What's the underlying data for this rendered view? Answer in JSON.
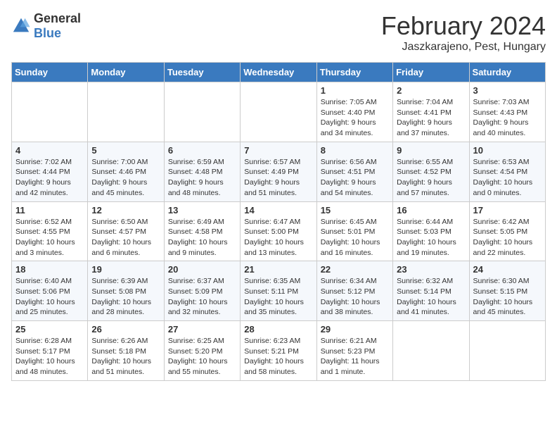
{
  "header": {
    "logo_general": "General",
    "logo_blue": "Blue",
    "month_year": "February 2024",
    "location": "Jaszkarajeno, Pest, Hungary"
  },
  "days_of_week": [
    "Sunday",
    "Monday",
    "Tuesday",
    "Wednesday",
    "Thursday",
    "Friday",
    "Saturday"
  ],
  "weeks": [
    [
      {
        "day": "",
        "info": ""
      },
      {
        "day": "",
        "info": ""
      },
      {
        "day": "",
        "info": ""
      },
      {
        "day": "",
        "info": ""
      },
      {
        "day": "1",
        "info": "Sunrise: 7:05 AM\nSunset: 4:40 PM\nDaylight: 9 hours\nand 34 minutes."
      },
      {
        "day": "2",
        "info": "Sunrise: 7:04 AM\nSunset: 4:41 PM\nDaylight: 9 hours\nand 37 minutes."
      },
      {
        "day": "3",
        "info": "Sunrise: 7:03 AM\nSunset: 4:43 PM\nDaylight: 9 hours\nand 40 minutes."
      }
    ],
    [
      {
        "day": "4",
        "info": "Sunrise: 7:02 AM\nSunset: 4:44 PM\nDaylight: 9 hours\nand 42 minutes."
      },
      {
        "day": "5",
        "info": "Sunrise: 7:00 AM\nSunset: 4:46 PM\nDaylight: 9 hours\nand 45 minutes."
      },
      {
        "day": "6",
        "info": "Sunrise: 6:59 AM\nSunset: 4:48 PM\nDaylight: 9 hours\nand 48 minutes."
      },
      {
        "day": "7",
        "info": "Sunrise: 6:57 AM\nSunset: 4:49 PM\nDaylight: 9 hours\nand 51 minutes."
      },
      {
        "day": "8",
        "info": "Sunrise: 6:56 AM\nSunset: 4:51 PM\nDaylight: 9 hours\nand 54 minutes."
      },
      {
        "day": "9",
        "info": "Sunrise: 6:55 AM\nSunset: 4:52 PM\nDaylight: 9 hours\nand 57 minutes."
      },
      {
        "day": "10",
        "info": "Sunrise: 6:53 AM\nSunset: 4:54 PM\nDaylight: 10 hours\nand 0 minutes."
      }
    ],
    [
      {
        "day": "11",
        "info": "Sunrise: 6:52 AM\nSunset: 4:55 PM\nDaylight: 10 hours\nand 3 minutes."
      },
      {
        "day": "12",
        "info": "Sunrise: 6:50 AM\nSunset: 4:57 PM\nDaylight: 10 hours\nand 6 minutes."
      },
      {
        "day": "13",
        "info": "Sunrise: 6:49 AM\nSunset: 4:58 PM\nDaylight: 10 hours\nand 9 minutes."
      },
      {
        "day": "14",
        "info": "Sunrise: 6:47 AM\nSunset: 5:00 PM\nDaylight: 10 hours\nand 13 minutes."
      },
      {
        "day": "15",
        "info": "Sunrise: 6:45 AM\nSunset: 5:01 PM\nDaylight: 10 hours\nand 16 minutes."
      },
      {
        "day": "16",
        "info": "Sunrise: 6:44 AM\nSunset: 5:03 PM\nDaylight: 10 hours\nand 19 minutes."
      },
      {
        "day": "17",
        "info": "Sunrise: 6:42 AM\nSunset: 5:05 PM\nDaylight: 10 hours\nand 22 minutes."
      }
    ],
    [
      {
        "day": "18",
        "info": "Sunrise: 6:40 AM\nSunset: 5:06 PM\nDaylight: 10 hours\nand 25 minutes."
      },
      {
        "day": "19",
        "info": "Sunrise: 6:39 AM\nSunset: 5:08 PM\nDaylight: 10 hours\nand 28 minutes."
      },
      {
        "day": "20",
        "info": "Sunrise: 6:37 AM\nSunset: 5:09 PM\nDaylight: 10 hours\nand 32 minutes."
      },
      {
        "day": "21",
        "info": "Sunrise: 6:35 AM\nSunset: 5:11 PM\nDaylight: 10 hours\nand 35 minutes."
      },
      {
        "day": "22",
        "info": "Sunrise: 6:34 AM\nSunset: 5:12 PM\nDaylight: 10 hours\nand 38 minutes."
      },
      {
        "day": "23",
        "info": "Sunrise: 6:32 AM\nSunset: 5:14 PM\nDaylight: 10 hours\nand 41 minutes."
      },
      {
        "day": "24",
        "info": "Sunrise: 6:30 AM\nSunset: 5:15 PM\nDaylight: 10 hours\nand 45 minutes."
      }
    ],
    [
      {
        "day": "25",
        "info": "Sunrise: 6:28 AM\nSunset: 5:17 PM\nDaylight: 10 hours\nand 48 minutes."
      },
      {
        "day": "26",
        "info": "Sunrise: 6:26 AM\nSunset: 5:18 PM\nDaylight: 10 hours\nand 51 minutes."
      },
      {
        "day": "27",
        "info": "Sunrise: 6:25 AM\nSunset: 5:20 PM\nDaylight: 10 hours\nand 55 minutes."
      },
      {
        "day": "28",
        "info": "Sunrise: 6:23 AM\nSunset: 5:21 PM\nDaylight: 10 hours\nand 58 minutes."
      },
      {
        "day": "29",
        "info": "Sunrise: 6:21 AM\nSunset: 5:23 PM\nDaylight: 11 hours\nand 1 minute."
      },
      {
        "day": "",
        "info": ""
      },
      {
        "day": "",
        "info": ""
      }
    ]
  ]
}
